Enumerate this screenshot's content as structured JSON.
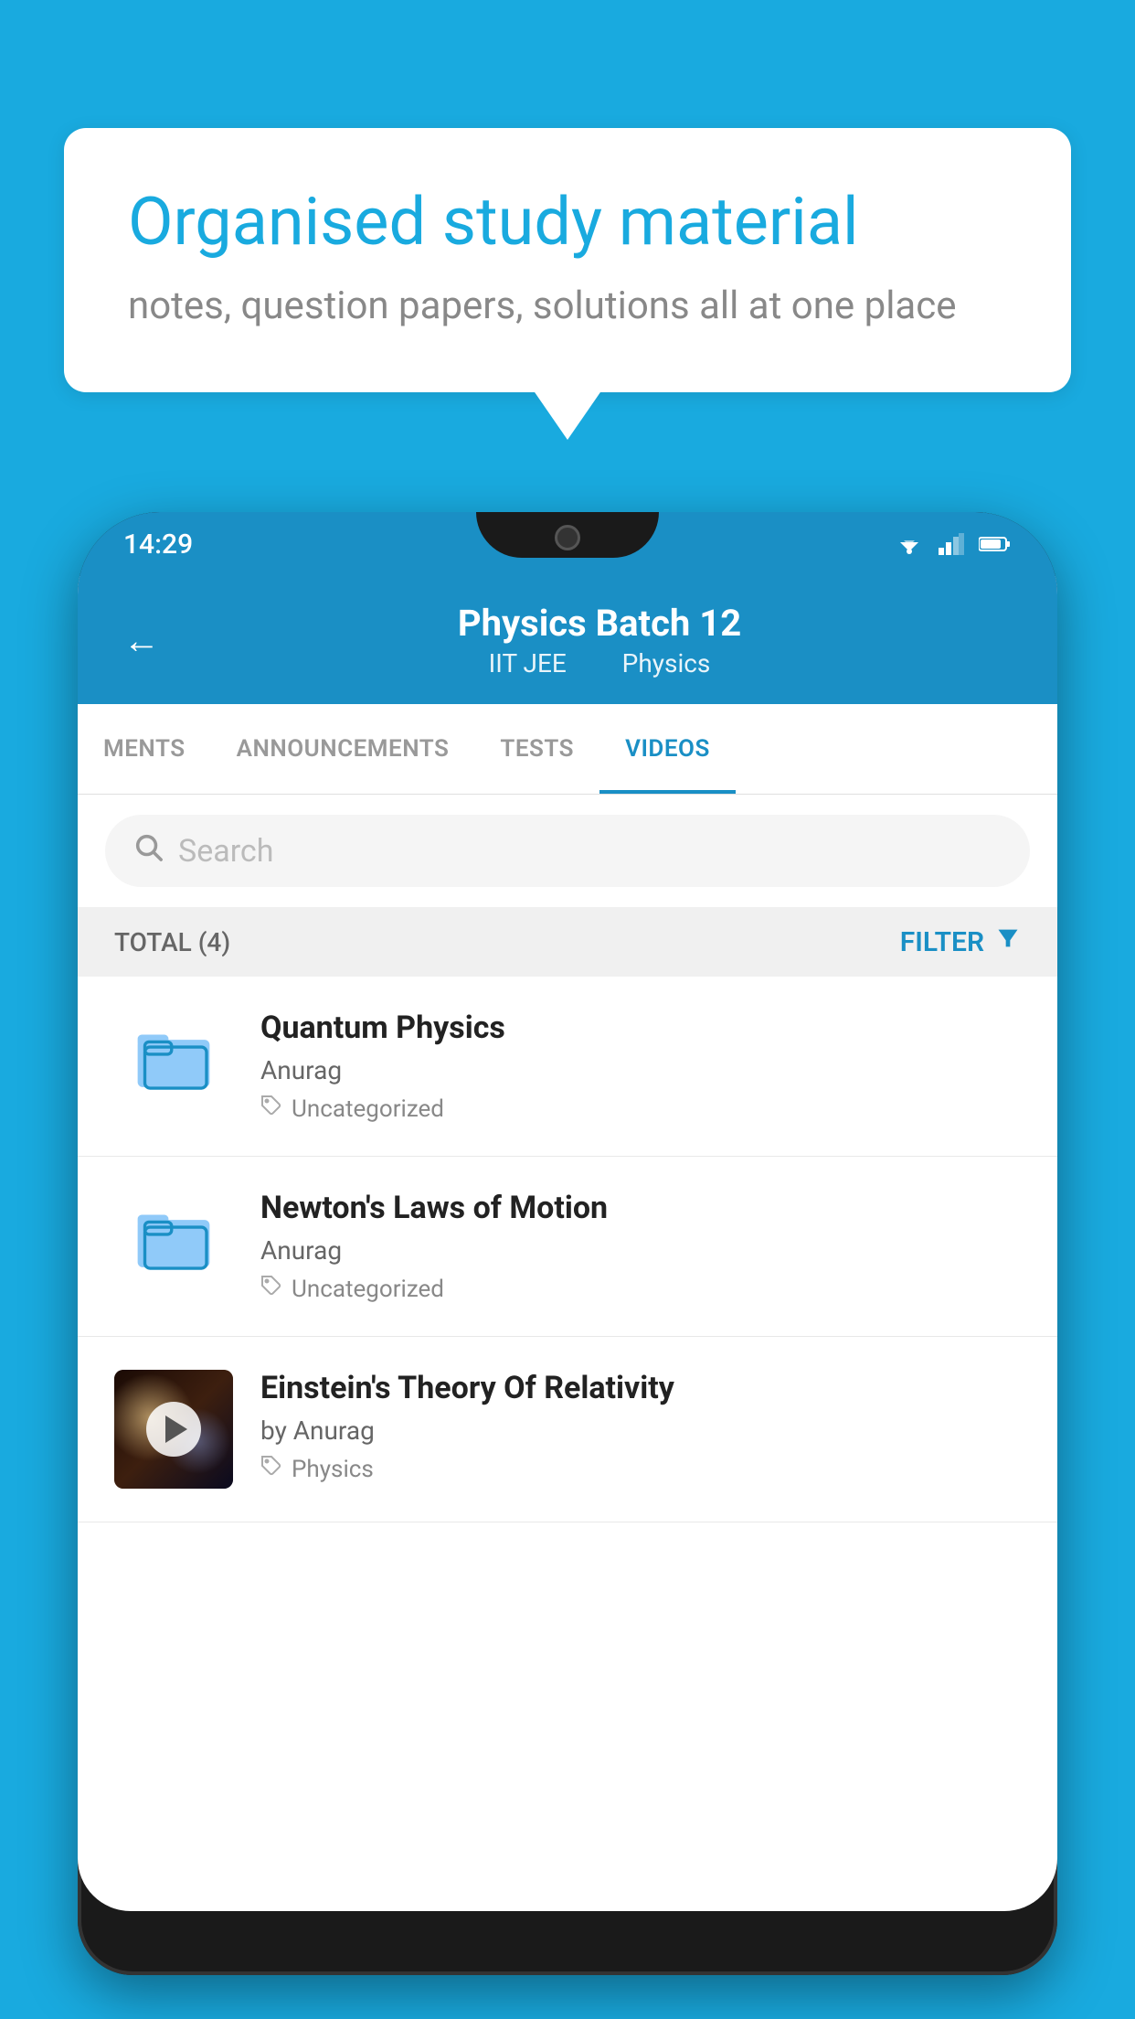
{
  "background_color": "#19AADF",
  "speech_bubble": {
    "heading": "Organised study material",
    "subtext": "notes, question papers, solutions all at one place"
  },
  "phone": {
    "status_bar": {
      "time": "14:29"
    },
    "header": {
      "back_label": "←",
      "title": "Physics Batch 12",
      "subtitle_part1": "IIT JEE",
      "subtitle_part2": "Physics"
    },
    "tabs": [
      {
        "label": "MENTS",
        "active": false
      },
      {
        "label": "ANNOUNCEMENTS",
        "active": false
      },
      {
        "label": "TESTS",
        "active": false
      },
      {
        "label": "VIDEOS",
        "active": true
      }
    ],
    "search": {
      "placeholder": "Search"
    },
    "filter_row": {
      "total_label": "TOTAL (4)",
      "filter_label": "FILTER"
    },
    "video_list": [
      {
        "title": "Quantum Physics",
        "author": "Anurag",
        "tag": "Uncategorized",
        "type": "folder"
      },
      {
        "title": "Newton's Laws of Motion",
        "author": "Anurag",
        "tag": "Uncategorized",
        "type": "folder"
      },
      {
        "title": "Einstein's Theory Of Relativity",
        "author": "by Anurag",
        "tag": "Physics",
        "type": "video"
      }
    ]
  }
}
